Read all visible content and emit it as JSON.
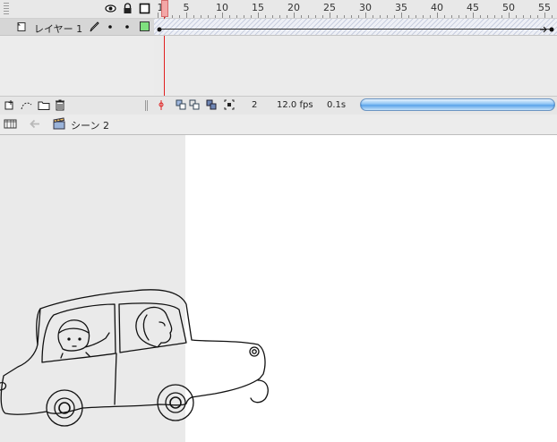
{
  "timeline": {
    "frame_numbers": [
      "1",
      "5",
      "10",
      "15",
      "20",
      "25",
      "30",
      "35",
      "40",
      "45",
      "50",
      "55"
    ],
    "layer": {
      "name": "レイヤー 1",
      "keyframe_color": "#7fe07f"
    },
    "controls": {
      "current_frame": "2",
      "frame_rate": "12.0 fps",
      "elapsed_time": "0.1s"
    }
  },
  "scene_bar": {
    "scene_name": "シーン 2"
  },
  "colors": {
    "playhead": "#e02020",
    "stage_bg": "#ffffff",
    "pasteboard": "#eaeaea"
  }
}
